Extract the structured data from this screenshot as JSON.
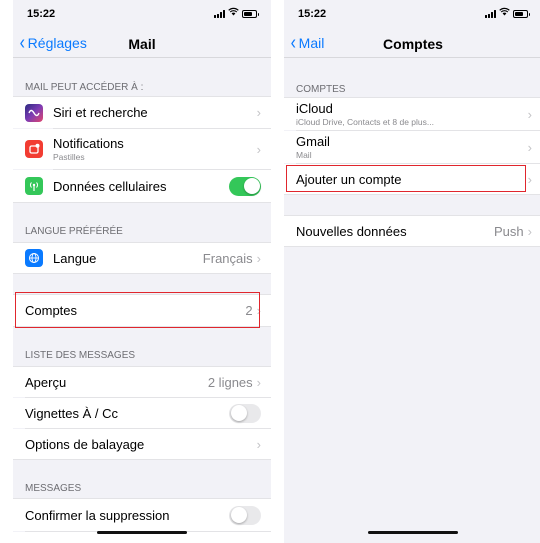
{
  "left": {
    "status": {
      "time": "15:22"
    },
    "nav": {
      "back": "Réglages",
      "title": "Mail"
    },
    "section_access": "MAIL PEUT ACCÉDER À :",
    "siri": {
      "label": "Siri et recherche"
    },
    "notifications": {
      "label": "Notifications",
      "sub": "Pastilles"
    },
    "cellular": {
      "label": "Données cellulaires",
      "state": "on"
    },
    "section_language": "LANGUE PRÉFÉRÉE",
    "language": {
      "label": "Langue",
      "value": "Français"
    },
    "accounts": {
      "label": "Comptes",
      "value": "2"
    },
    "section_list": "LISTE DES MESSAGES",
    "preview": {
      "label": "Aperçu",
      "value": "2 lignes"
    },
    "thumbnails": {
      "label": "Vignettes À / Cc",
      "state": "off"
    },
    "swipe": {
      "label": "Options de balayage"
    },
    "section_messages": "MESSAGES",
    "confirm_delete": {
      "label": "Confirmer la suppression",
      "state": "off"
    }
  },
  "right": {
    "status": {
      "time": "15:22"
    },
    "nav": {
      "back": "Mail",
      "title": "Comptes"
    },
    "section_accounts": "COMPTES",
    "icloud": {
      "label": "iCloud",
      "sub": "iCloud Drive, Contacts et 8 de plus..."
    },
    "gmail": {
      "label": "Gmail",
      "sub": "Mail"
    },
    "add_account": {
      "label": "Ajouter un compte"
    },
    "fetch": {
      "label": "Nouvelles données",
      "value": "Push"
    }
  },
  "colors": {
    "accent": "#0a7aff",
    "highlight": "#e0262d",
    "toggle_on": "#34c759"
  },
  "icons": {
    "siri": "siri-icon",
    "notifications": "notifications-icon",
    "cellular": "antenna-icon",
    "language": "globe-icon"
  }
}
